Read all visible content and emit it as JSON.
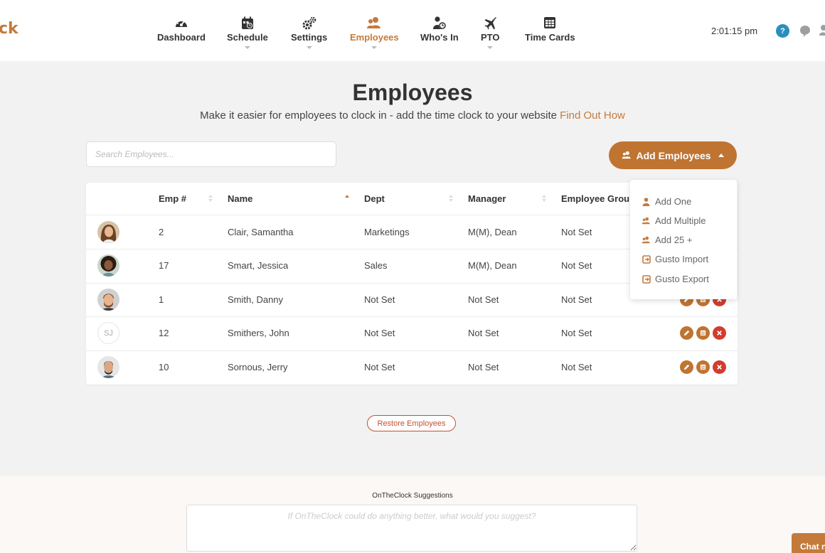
{
  "app": {
    "logo_text": "ck",
    "clock": "2:01:15 pm",
    "help_label": "?"
  },
  "nav": {
    "items": [
      {
        "label": "Dashboard",
        "icon": "speedometer-icon"
      },
      {
        "label": "Schedule",
        "icon": "calendar-icon"
      },
      {
        "label": "Settings",
        "icon": "gears-icon"
      },
      {
        "label": "Employees",
        "icon": "users-icon"
      },
      {
        "label": "Who's In",
        "icon": "user-clock-icon"
      },
      {
        "label": "PTO",
        "icon": "plane-icon"
      },
      {
        "label": "Time Cards",
        "icon": "table-icon"
      }
    ]
  },
  "page": {
    "title": "Employees",
    "subtitle": "Make it easier for employees to clock in - add the time clock to your website",
    "subtitle_link": "Find Out How"
  },
  "search": {
    "placeholder": "Search Employees..."
  },
  "add_button": {
    "label": "Add Employees"
  },
  "dropdown": {
    "items": [
      {
        "label": "Add One",
        "icon": "user-icon"
      },
      {
        "label": "Add Multiple",
        "icon": "users-icon"
      },
      {
        "label": "Add 25 +",
        "icon": "users-icon"
      },
      {
        "label": "Gusto Import",
        "icon": "sign-in-icon"
      },
      {
        "label": "Gusto Export",
        "icon": "sign-in-icon"
      }
    ]
  },
  "table": {
    "columns": [
      "Emp #",
      "Name",
      "Dept",
      "Manager",
      "Employee Group"
    ],
    "rows": [
      {
        "avatar": "photo",
        "initials": "",
        "emp": "2",
        "name": "Clair, Samantha",
        "dept": "Marketings",
        "manager": "M(M), Dean",
        "group": "Not Set"
      },
      {
        "avatar": "photo",
        "initials": "",
        "emp": "17",
        "name": "Smart, Jessica",
        "dept": "Sales",
        "manager": "M(M), Dean",
        "group": "Not Set"
      },
      {
        "avatar": "photo",
        "initials": "",
        "emp": "1",
        "name": "Smith, Danny",
        "dept": "Not Set",
        "manager": "Not Set",
        "group": "Not Set"
      },
      {
        "avatar": "initials",
        "initials": "SJ",
        "emp": "12",
        "name": "Smithers, John",
        "dept": "Not Set",
        "manager": "Not Set",
        "group": "Not Set"
      },
      {
        "avatar": "photo",
        "initials": "",
        "emp": "10",
        "name": "Sornous, Jerry",
        "dept": "Not Set",
        "manager": "Not Set",
        "group": "Not Set"
      }
    ]
  },
  "restore_button": {
    "label": "Restore Employees"
  },
  "suggestions": {
    "label": "OnTheClock Suggestions",
    "placeholder": "If OnTheClock could do anything better, what would you suggest?"
  },
  "chat": {
    "label": "Chat now"
  },
  "colors": {
    "accent": "#c47a3a",
    "danger": "#d33c2c",
    "help": "#2a8fbd"
  }
}
